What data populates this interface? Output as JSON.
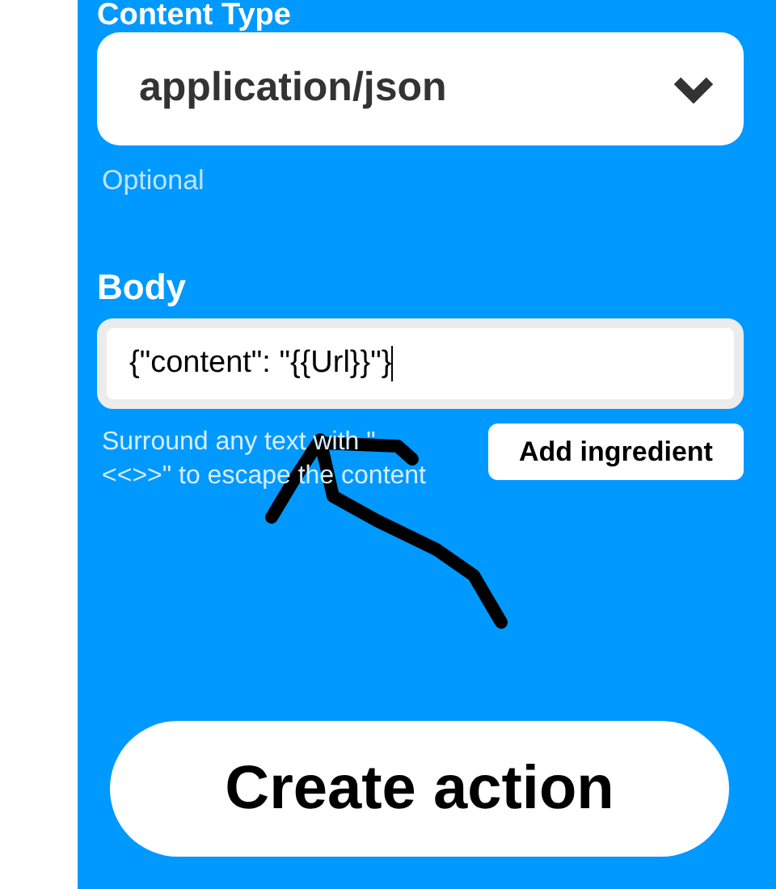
{
  "content_type": {
    "label": "Content Type",
    "value": "application/json",
    "hint": "Optional"
  },
  "body": {
    "label": "Body",
    "value": "{\"content\": \"{{Url}}\"}",
    "hint": "Surround any text with \"<<>>\" to escape the content",
    "button": "Add ingredient"
  },
  "submit_button": "Create action"
}
